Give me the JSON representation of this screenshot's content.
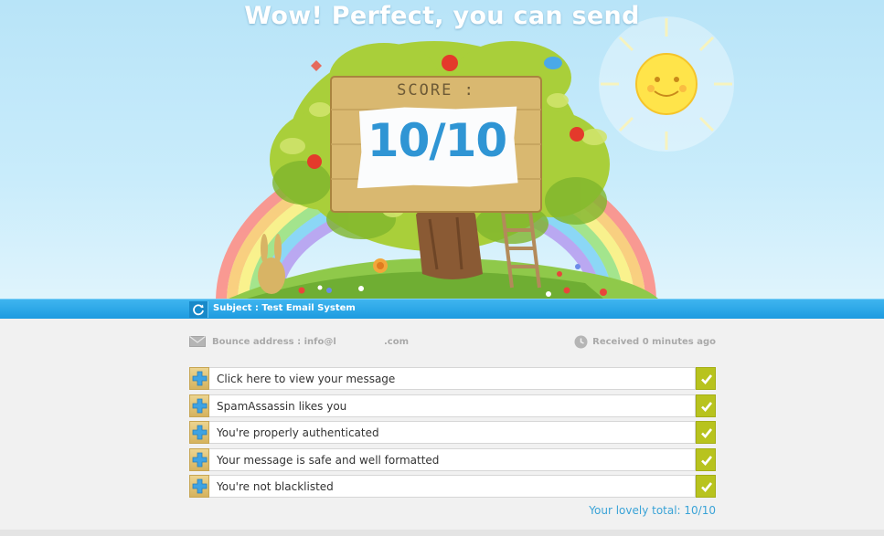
{
  "hero": {
    "title": "Wow! Perfect, you can send",
    "score_label": "SCORE :",
    "score_value": "10/10"
  },
  "subject_bar": {
    "refresh_icon": "refresh-icon",
    "subject_text": "Subject : Test Email System"
  },
  "meta": {
    "bounce_icon": "envelope-icon",
    "bounce_text": "Bounce address : info@l               .com",
    "received_icon": "clock-icon",
    "received_text": "Received 0 minutes ago"
  },
  "results": [
    {
      "label": "Click here to view your message",
      "status": "pass"
    },
    {
      "label": "SpamAssassin likes you",
      "status": "pass"
    },
    {
      "label": "You're properly authenticated",
      "status": "pass"
    },
    {
      "label": "Your message is safe and well formatted",
      "status": "pass"
    },
    {
      "label": "You're not blacklisted",
      "status": "pass"
    }
  ],
  "total_text": "Your lovely total: 10/10",
  "colors": {
    "sky": "#c9ecfb",
    "subject_bar": "#1d9be0",
    "score_text": "#2f95d4",
    "check_green": "#b8c31e",
    "plus_gold": "#d6b35e",
    "total_text": "#3aa3d7"
  }
}
